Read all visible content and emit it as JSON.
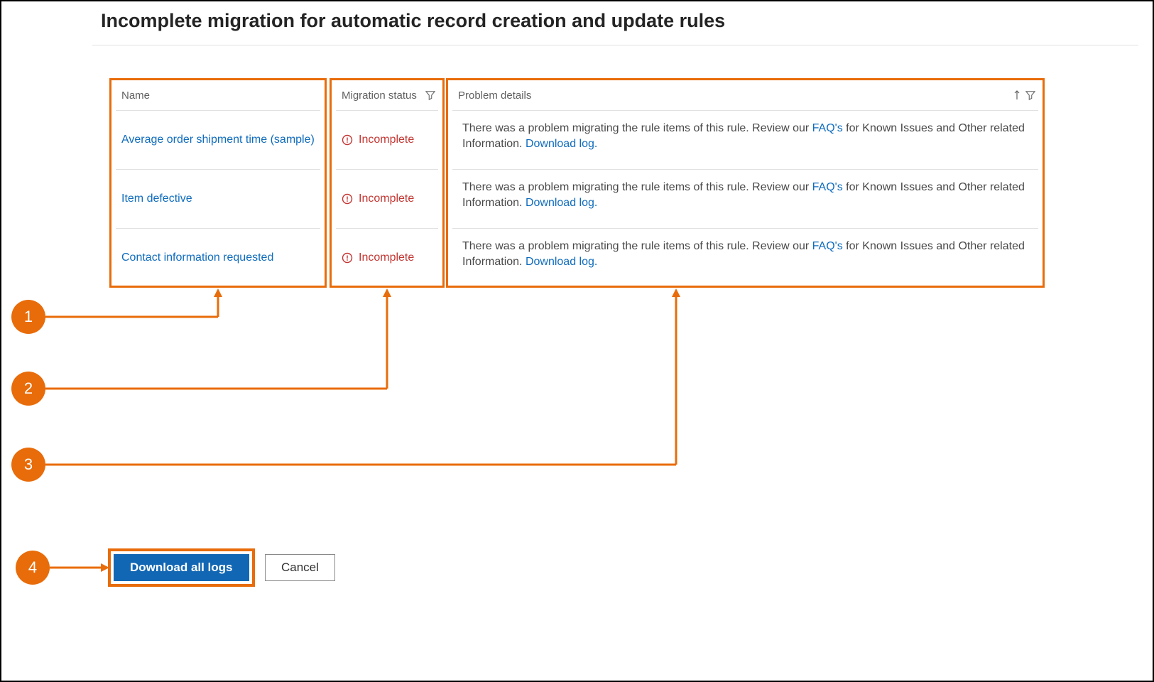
{
  "title": "Incomplete migration for automatic record creation and update rules",
  "columns": {
    "name": "Name",
    "status": "Migration status",
    "details": "Problem details"
  },
  "rows": [
    {
      "name": "Average order shipment time (sample)",
      "status": "Incomplete",
      "details_prefix": "There was a problem migrating the rule items of this rule. Review our ",
      "faq_link": "FAQ's",
      "details_mid": " for Known Issues and Other related Information. ",
      "download_link": "Download log."
    },
    {
      "name": "Item defective",
      "status": "Incomplete",
      "details_prefix": "There was a problem migrating the rule items of this rule. Review our ",
      "faq_link": "FAQ's",
      "details_mid": " for Known Issues and Other related Information. ",
      "download_link": "Download log."
    },
    {
      "name": "Contact information requested",
      "status": "Incomplete",
      "details_prefix": "There was a problem migrating the rule items of this rule. Review our ",
      "faq_link": "FAQ's",
      "details_mid": " for Known Issues and Other related Information. ",
      "download_link": "Download log."
    }
  ],
  "annotations": [
    "1",
    "2",
    "3",
    "4"
  ],
  "buttons": {
    "download": "Download all logs",
    "cancel": "Cancel"
  }
}
